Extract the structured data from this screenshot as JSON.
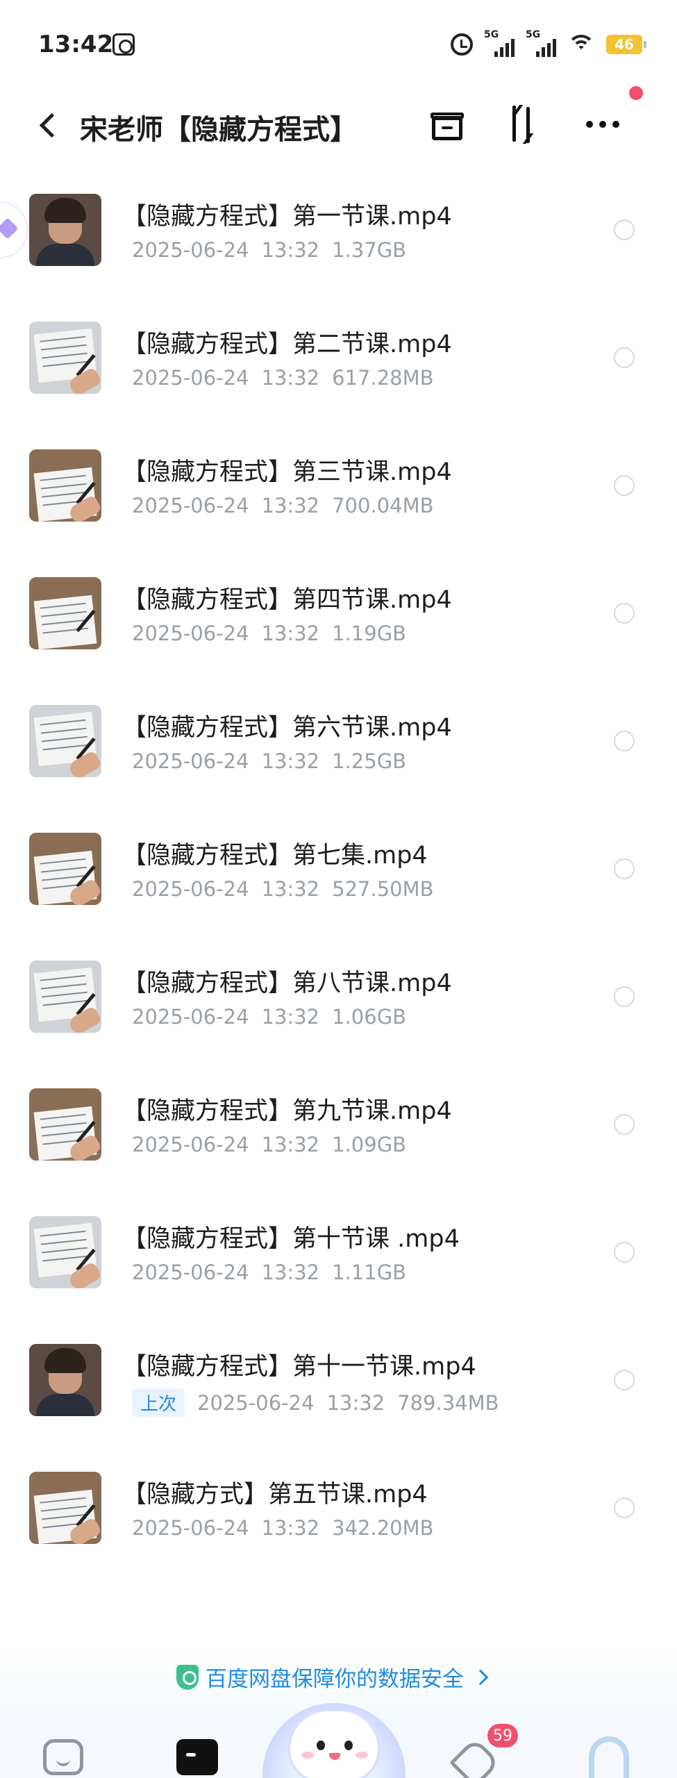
{
  "status_bar": {
    "time": "13:42",
    "signal1_label": "5G",
    "signal2_label": "5G",
    "battery": "46"
  },
  "header": {
    "title": "宋老师【隐藏方程式】"
  },
  "files": [
    {
      "name": "【隐藏方程式】第一节课.mp4",
      "date": "2025-06-24",
      "time": "13:32",
      "size": "1.37GB",
      "tag": ""
    },
    {
      "name": "【隐藏方程式】第二节课.mp4",
      "date": "2025-06-24",
      "time": "13:32",
      "size": "617.28MB",
      "tag": ""
    },
    {
      "name": "【隐藏方程式】第三节课.mp4",
      "date": "2025-06-24",
      "time": "13:32",
      "size": "700.04MB",
      "tag": ""
    },
    {
      "name": "【隐藏方程式】第四节课.mp4",
      "date": "2025-06-24",
      "time": "13:32",
      "size": "1.19GB",
      "tag": ""
    },
    {
      "name": "【隐藏方程式】第六节课.mp4",
      "date": "2025-06-24",
      "time": "13:32",
      "size": "1.25GB",
      "tag": ""
    },
    {
      "name": "【隐藏方程式】第七集.mp4",
      "date": "2025-06-24",
      "time": "13:32",
      "size": "527.50MB",
      "tag": ""
    },
    {
      "name": "【隐藏方程式】第八节课.mp4",
      "date": "2025-06-24",
      "time": "13:32",
      "size": "1.06GB",
      "tag": ""
    },
    {
      "name": "【隐藏方程式】第九节课.mp4",
      "date": "2025-06-24",
      "time": "13:32",
      "size": "1.09GB",
      "tag": ""
    },
    {
      "name": "【隐藏方程式】第十节课 .mp4",
      "date": "2025-06-24",
      "time": "13:32",
      "size": "1.11GB",
      "tag": ""
    },
    {
      "name": "【隐藏方程式】第十一节课.mp4",
      "date": "2025-06-24",
      "time": "13:32",
      "size": "789.34MB",
      "tag": "上次"
    },
    {
      "name": "【隐藏方式】第五节课.mp4",
      "date": "2025-06-24",
      "time": "13:32",
      "size": "342.20MB",
      "tag": ""
    }
  ],
  "footer": {
    "security_text": "百度网盘保障你的数据安全"
  },
  "bottom_nav": {
    "badge_count": "59"
  },
  "colors": {
    "accent": "#1f8ce0",
    "badge": "#f0506e",
    "meta_text": "#9aa0a6"
  },
  "icons": [
    "back-icon",
    "archive-icon",
    "sort-icon",
    "more-icon",
    "shield-icon",
    "home-icon",
    "files-icon",
    "mascot-icon",
    "send-icon",
    "profile-icon"
  ]
}
